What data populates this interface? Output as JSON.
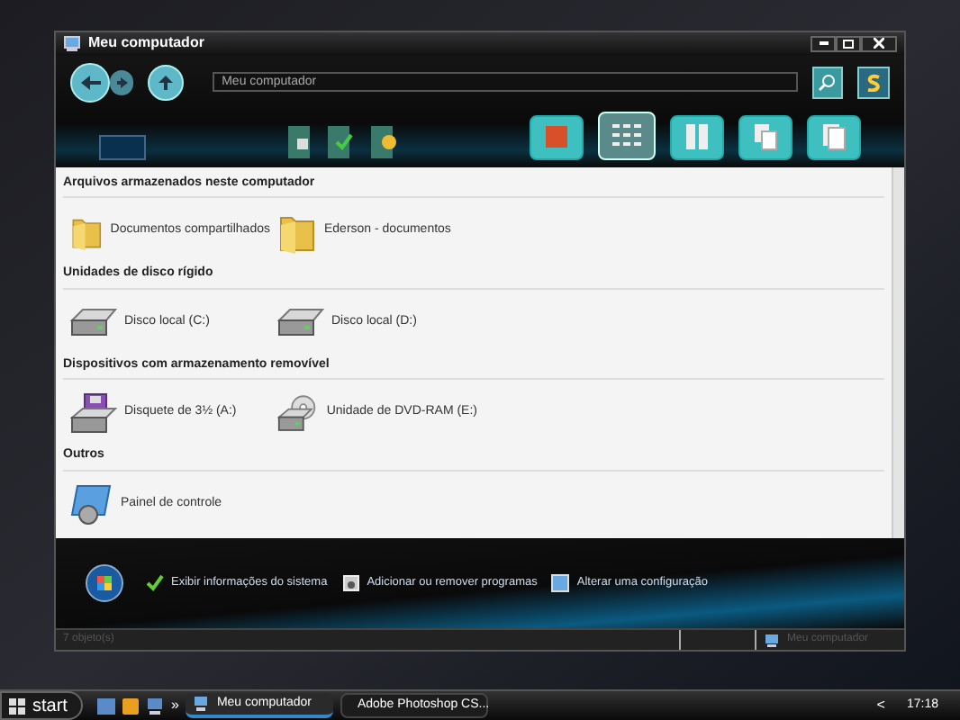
{
  "window": {
    "title": "Meu computador"
  },
  "address_bar": {
    "value": "Meu computador"
  },
  "sections": [
    {
      "title": "Arquivos armazenados neste computador",
      "items": [
        {
          "label": "Documentos compartilhados",
          "kind": "folder"
        },
        {
          "label": "Ederson - documentos",
          "kind": "folder"
        }
      ]
    },
    {
      "title": "Unidades de disco rígido",
      "items": [
        {
          "label": "Disco local (C:)",
          "kind": "drive"
        },
        {
          "label": "Disco local (D:)",
          "kind": "drive"
        }
      ]
    },
    {
      "title": "Dispositivos com armazenamento removível",
      "items": [
        {
          "label": "Disquete de 3½ (A:)",
          "kind": "floppy"
        },
        {
          "label": "Unidade de DVD-RAM (E:)",
          "kind": "dvd"
        }
      ]
    },
    {
      "title": "Outros",
      "items": [
        {
          "label": "Painel de controle",
          "kind": "control"
        }
      ]
    }
  ],
  "tasks": [
    {
      "label": "Exibir informações do sistema",
      "kind": "check"
    },
    {
      "label": "Adicionar ou remover programas",
      "kind": "install"
    },
    {
      "label": "Alterar uma configuração",
      "kind": "settings"
    }
  ],
  "status_bar": {
    "count": "7 objeto(s)",
    "location": "Meu computador"
  },
  "taskbar": {
    "start": "start",
    "chevron": "»",
    "windows": [
      {
        "label": "Meu computador",
        "selected": true
      },
      {
        "label": "Adobe Photoshop CS...",
        "selected": false
      }
    ],
    "tray_arrow": "<",
    "clock": "17:18"
  }
}
